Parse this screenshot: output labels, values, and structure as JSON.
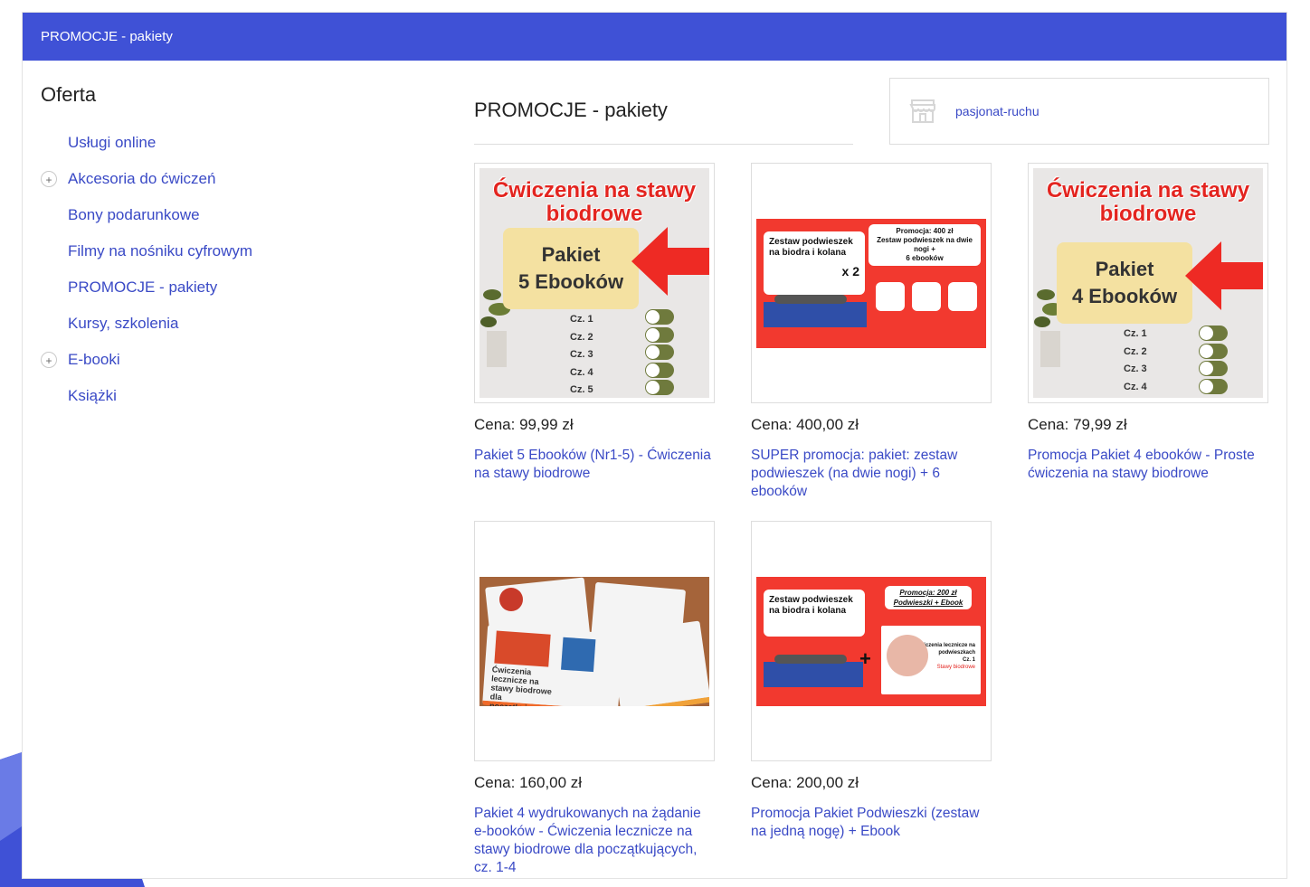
{
  "header": {
    "title": "PROMOCJE - pakiety"
  },
  "sidebar": {
    "heading": "Oferta",
    "items": [
      {
        "label": "Usługi online",
        "expandable": false
      },
      {
        "label": "Akcesoria do ćwiczeń",
        "expandable": true
      },
      {
        "label": "Bony podarunkowe",
        "expandable": false
      },
      {
        "label": "Filmy na nośniku cyfrowym",
        "expandable": false
      },
      {
        "label": "PROMOCJE - pakiety",
        "expandable": false
      },
      {
        "label": "Kursy, szkolenia",
        "expandable": false
      },
      {
        "label": "E-booki",
        "expandable": true
      },
      {
        "label": "Książki",
        "expandable": false
      }
    ],
    "expander_symbol": "+"
  },
  "main": {
    "title": "PROMOCJE - pakiety"
  },
  "shop": {
    "name": "pasjonat-ruchu",
    "icon": "store-icon"
  },
  "products": [
    {
      "price": "Cena: 99,99 zł",
      "title": "Pakiet 5 Ebooków (Nr1-5) - Ćwiczenia na stawy biodrowe",
      "image": {
        "heading": "Ćwiczenia na stawy biodrowe",
        "pack_line1": "Pakiet",
        "pack_line2": "5 Ebooków",
        "parts": [
          "Cz. 1",
          "Cz. 2",
          "Cz. 3",
          "Cz. 4",
          "Cz. 5"
        ]
      }
    },
    {
      "price": "Cena: 400,00 zł",
      "title": "SUPER promocja: pakiet: zestaw podwieszek (na dwie nogi) + 6 ebooków",
      "image": {
        "left_text": "Zestaw podwieszek na biodra i kolana",
        "multiplier": "x 2",
        "promo_line1": "Promocja: 400 zł",
        "promo_line2": "Zestaw podwieszek na dwie nogi +",
        "promo_line3": "6 ebooków"
      }
    },
    {
      "price": "Cena: 79,99 zł",
      "title": "Promocja Pakiet 4 ebooków - Proste ćwiczenia na stawy biodrowe",
      "image": {
        "heading": "Ćwiczenia na stawy biodrowe",
        "pack_line1": "Pakiet",
        "pack_line2": "4 Ebooków",
        "parts": [
          "Cz. 1",
          "Cz. 2",
          "Cz. 3",
          "Cz. 4"
        ]
      }
    },
    {
      "price": "Cena: 160,00 zł",
      "title": "Pakiet 4 wydrukowanych na żądanie e-booków - Ćwiczenia lecznicze na stawy biodrowe dla początkujących, cz. 1-4",
      "image": {
        "sheet_text": "Ćwiczenia lecznicze na stawy biodrowe dla początkujących"
      }
    },
    {
      "price": "Cena: 200,00 zł",
      "title": "Promocja Pakiet Podwieszki (zestaw na jedną nogę) + Ebook",
      "image": {
        "left_text": "Zestaw podwieszek na biodra i kolana",
        "promo_line1": "Promocja: 200 zł",
        "promo_line2": "Podwieszki + Ebook",
        "ebook_line1": "Ćwiczenia lecznicze na podwieszkach",
        "ebook_line2": "Cz. 1",
        "ebook_line3": "Stawy biodrowe",
        "plus": "+"
      }
    }
  ],
  "colors": {
    "header_bg": "#3f51d6",
    "link": "#3a4ac6",
    "promo_red": "#f2392f",
    "title_red": "#e3241f"
  }
}
